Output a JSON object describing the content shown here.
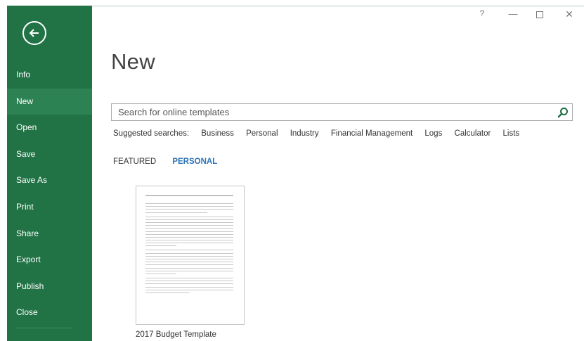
{
  "sidebar": {
    "items": [
      {
        "label": "Info"
      },
      {
        "label": "New"
      },
      {
        "label": "Open"
      },
      {
        "label": "Save"
      },
      {
        "label": "Save As"
      },
      {
        "label": "Print"
      },
      {
        "label": "Share"
      },
      {
        "label": "Export"
      },
      {
        "label": "Publish"
      },
      {
        "label": "Close"
      }
    ],
    "active": "New",
    "color": "#217346",
    "active_color": "#2d8253"
  },
  "window_controls": {
    "help": "?",
    "minimize": "—",
    "close": "✕"
  },
  "main": {
    "title": "New",
    "search": {
      "placeholder": "Search for online templates",
      "icon": "search-icon"
    },
    "suggested": {
      "label": "Suggested searches:",
      "links": [
        "Business",
        "Personal",
        "Industry",
        "Financial Management",
        "Logs",
        "Calculator",
        "Lists"
      ]
    },
    "tabs": [
      {
        "label": "FEATURED",
        "selected": false
      },
      {
        "label": "PERSONAL",
        "selected": true
      }
    ],
    "templates": [
      {
        "name": "2017 Budget Template"
      }
    ]
  }
}
